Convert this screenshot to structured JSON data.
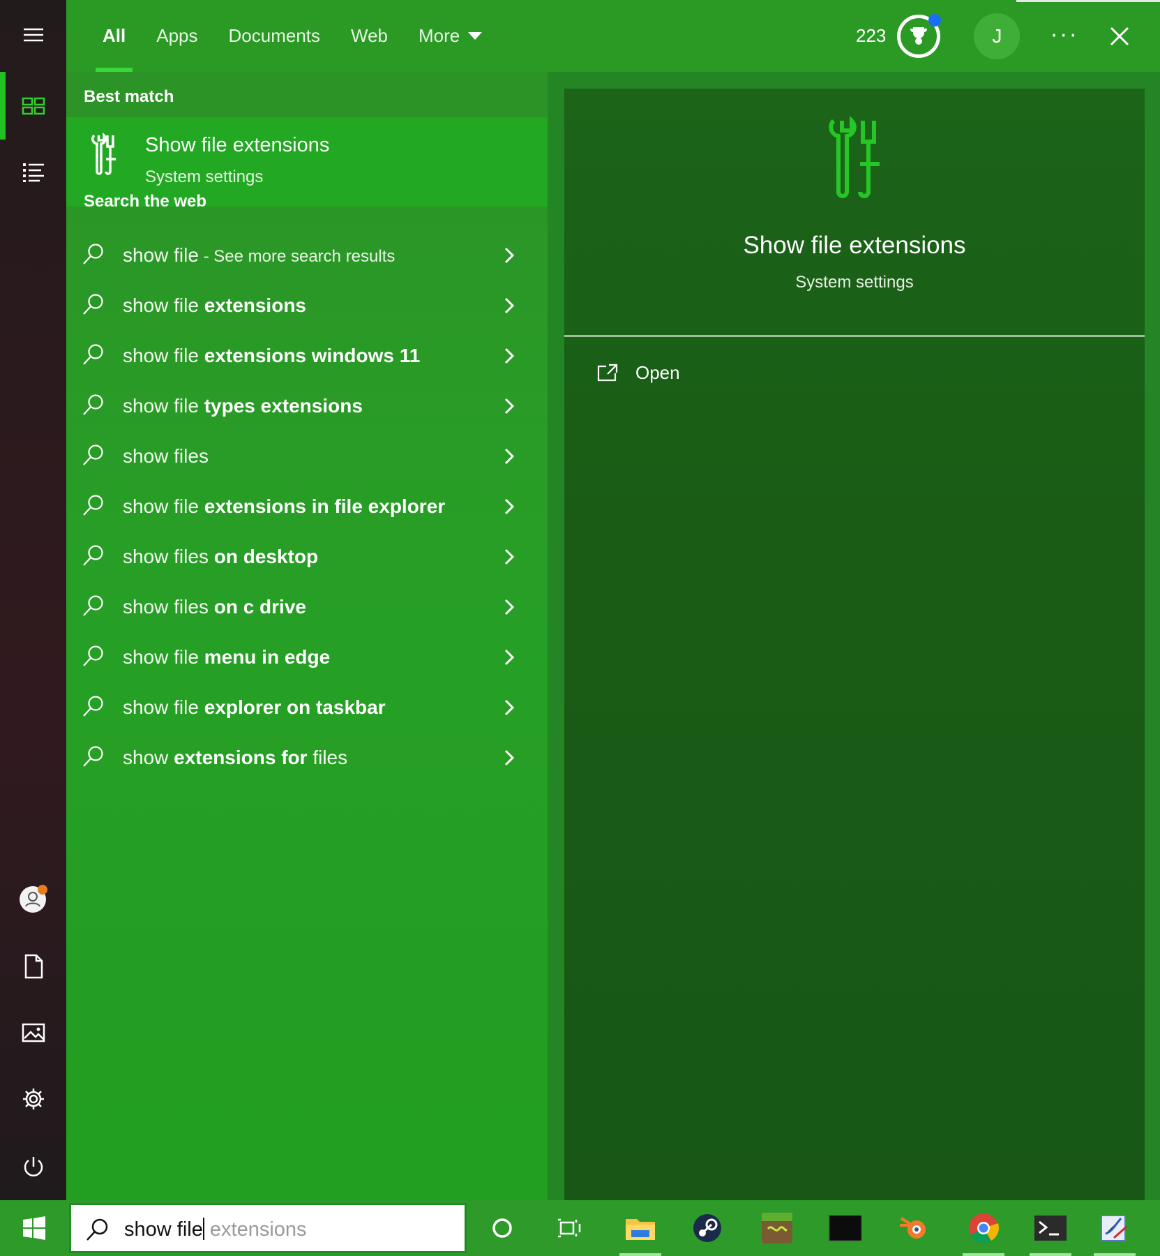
{
  "tabs": [
    {
      "label": "All",
      "active": true
    },
    {
      "label": "Apps"
    },
    {
      "label": "Documents"
    },
    {
      "label": "Web"
    },
    {
      "label": "More"
    }
  ],
  "header": {
    "points": "223",
    "avatar_initial": "J",
    "more_options": "···"
  },
  "best_match": {
    "heading": "Best match",
    "title": "Show file extensions",
    "subtitle": "System settings"
  },
  "web": {
    "heading": "Search the web",
    "results": [
      {
        "normal": "show file",
        "bold": "",
        "more": " - See more search results"
      },
      {
        "normal": "show file ",
        "bold": "extensions"
      },
      {
        "normal": "show file ",
        "bold": "extensions windows 11"
      },
      {
        "normal": "show file ",
        "bold": "types extensions"
      },
      {
        "normal": "show files",
        "bold": ""
      },
      {
        "normal": "show file ",
        "bold": "extensions in file explorer"
      },
      {
        "normal": "show files ",
        "bold": "on desktop"
      },
      {
        "normal": "show files ",
        "bold": "on c drive"
      },
      {
        "normal": "show file ",
        "bold": "menu in edge"
      },
      {
        "normal": "show file ",
        "bold": "explorer on taskbar"
      },
      {
        "normal": "show ",
        "bold": "extensions for",
        "tail": " files"
      }
    ]
  },
  "preview": {
    "title": "Show file extensions",
    "subtitle": "System settings",
    "action_open": "Open"
  },
  "search_box": {
    "typed": "show file",
    "suggestion": "extensions"
  },
  "rail_icons": [
    "hamburger-icon",
    "home-grid-icon",
    "list-icon",
    "account-icon",
    "document-icon",
    "pictures-icon",
    "settings-gear-icon",
    "power-icon"
  ],
  "taskbar_icons": [
    "cortana-icon",
    "task-view-icon",
    "file-explorer-icon",
    "steam-icon",
    "minecraft-icon",
    "terminal-black-icon",
    "blender-icon",
    "chrome-icon",
    "powershell-icon",
    "paint-icon"
  ],
  "colors": {
    "accent": "#22c022",
    "left_panel": "#279f26",
    "best_match_bg": "#22a823",
    "preview_bg": "#1a5c16",
    "notification_dot": "#1a6ef5"
  }
}
